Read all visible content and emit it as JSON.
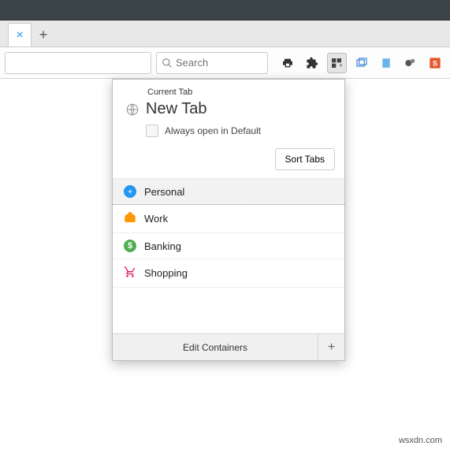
{
  "tabstrip": {
    "close_glyph": "×",
    "newtab_glyph": "+"
  },
  "toolbar": {
    "search_placeholder": "Search"
  },
  "popup": {
    "section_label": "Current Tab",
    "title": "New Tab",
    "always_open_label": "Always open in Default",
    "sort_label": "Sort Tabs",
    "containers": [
      {
        "label": "Personal",
        "color": "#2196f3",
        "icon": "plus",
        "selected": true
      },
      {
        "label": "Work",
        "color": "#ff9800",
        "icon": "briefcase",
        "selected": false
      },
      {
        "label": "Banking",
        "color": "#4caf50",
        "icon": "dollar",
        "selected": false
      },
      {
        "label": "Shopping",
        "color": "#e91e63",
        "icon": "cart",
        "selected": false
      }
    ],
    "footer_label": "Edit Containers",
    "footer_plus": "+"
  },
  "watermark": "wsxdn.com"
}
